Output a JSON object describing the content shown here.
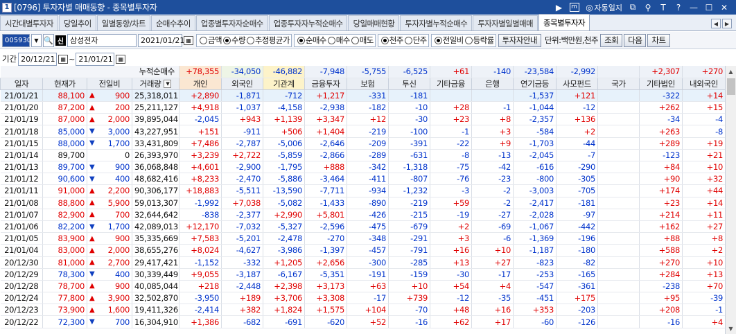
{
  "titlebar": {
    "num": "1",
    "title": "[0796] 투자자별 매매동향 - 종목별투자자",
    "auto_label": "자동일지",
    "icons": [
      "arrow-right-icon",
      "m-icon",
      "auto-journal-icon",
      "copy-icon",
      "pin-icon",
      "font-size-icon",
      "help-icon",
      "minimize-icon",
      "maximize-icon",
      "close-icon"
    ]
  },
  "tabs": [
    "시간대별투자자",
    "당일추이",
    "일별동향/차트",
    "순매수추이",
    "업종별투자자순매수",
    "업종투자자누적순매수",
    "당일매매현황",
    "투자자별누적순매수",
    "투자자별일별매매",
    "종목별투자자"
  ],
  "active_tab": 9,
  "controls": {
    "code": "005930",
    "name": "삼성전자",
    "date": "2021/01/21",
    "sin": "신",
    "radio1": [
      {
        "label": "금액",
        "on": false
      },
      {
        "label": "수량",
        "on": true
      },
      {
        "label": "추정평균가",
        "on": false
      }
    ],
    "radio2": [
      {
        "label": "순매수",
        "on": true
      },
      {
        "label": "매수",
        "on": false
      },
      {
        "label": "매도",
        "on": false
      }
    ],
    "radio3": [
      {
        "label": "천주",
        "on": true
      },
      {
        "label": "단주",
        "on": false
      }
    ],
    "radio4": [
      {
        "label": "전일비",
        "on": true
      },
      {
        "label": "등락률",
        "on": false
      }
    ],
    "guide_btn": "투자자안내",
    "unit": "단위:백만원,천주",
    "search_btn": "조회",
    "next_btn": "다음",
    "chart_btn": "차트"
  },
  "period": {
    "label": "기간",
    "from": "20/12/21",
    "sep": "~",
    "to": "21/01/21",
    "cum_label": "누적순매수",
    "cum_values": [
      "+78,355",
      "-34,050",
      "-46,882",
      "-7,948",
      "-5,755",
      "-6,525",
      "+61",
      "-140",
      "-23,584",
      "-2,992",
      "",
      "+2,307",
      "+270"
    ]
  },
  "headers": [
    "일자",
    "현재가",
    "전일비",
    "거래량",
    "개인",
    "외국인",
    "기관계",
    "금융투자",
    "보험",
    "투신",
    "기타금융",
    "은행",
    "연기금등",
    "사모펀드",
    "국가",
    "기타법인",
    "내외국인"
  ],
  "rows": [
    [
      "21/01/21",
      "88,100",
      "up",
      "900",
      "25,318,011",
      "+2,890",
      "-1,871",
      "-712",
      "+1,217",
      "-331",
      "-181",
      "",
      "",
      "-1,537",
      "+121",
      "",
      "-322",
      "+14"
    ],
    [
      "21/01/20",
      "87,200",
      "up",
      "200",
      "25,211,127",
      "+4,918",
      "-1,037",
      "-4,158",
      "-2,938",
      "-182",
      "-10",
      "+28",
      "-1",
      "-1,044",
      "-12",
      "",
      "+262",
      "+15"
    ],
    [
      "21/01/19",
      "87,000",
      "up",
      "2,000",
      "39,895,044",
      "-2,045",
      "+943",
      "+1,139",
      "+3,347",
      "+12",
      "-30",
      "+23",
      "+8",
      "-2,357",
      "+136",
      "",
      "-34",
      "-4"
    ],
    [
      "21/01/18",
      "85,000",
      "down",
      "3,000",
      "43,227,951",
      "+151",
      "-911",
      "+506",
      "+1,404",
      "-219",
      "-100",
      "-1",
      "+3",
      "-584",
      "+2",
      "",
      "+263",
      "-8"
    ],
    [
      "21/01/15",
      "88,000",
      "down",
      "1,700",
      "33,431,809",
      "+7,486",
      "-2,787",
      "-5,006",
      "-2,646",
      "-209",
      "-391",
      "-22",
      "+9",
      "-1,703",
      "-44",
      "",
      "+289",
      "+19"
    ],
    [
      "21/01/14",
      "89,700",
      "",
      "0",
      "26,393,970",
      "+3,239",
      "+2,722",
      "-5,859",
      "-2,866",
      "-289",
      "-631",
      "-8",
      "-13",
      "-2,045",
      "-7",
      "",
      "-123",
      "+21"
    ],
    [
      "21/01/13",
      "89,700",
      "down",
      "900",
      "36,068,848",
      "+4,601",
      "-2,900",
      "-1,795",
      "+888",
      "-342",
      "-1,318",
      "-75",
      "-42",
      "-616",
      "-290",
      "",
      "+84",
      "+10"
    ],
    [
      "21/01/12",
      "90,600",
      "down",
      "400",
      "48,682,416",
      "+8,233",
      "-2,470",
      "-5,886",
      "-3,464",
      "-411",
      "-807",
      "-76",
      "-23",
      "-800",
      "-305",
      "",
      "+90",
      "+32"
    ],
    [
      "21/01/11",
      "91,000",
      "up",
      "2,200",
      "90,306,177",
      "+18,883",
      "-5,511",
      "-13,590",
      "-7,711",
      "-934",
      "-1,232",
      "-3",
      "-2",
      "-3,003",
      "-705",
      "",
      "+174",
      "+44"
    ],
    [
      "21/01/08",
      "88,800",
      "up",
      "5,900",
      "59,013,307",
      "-1,992",
      "+7,038",
      "-5,082",
      "-1,433",
      "-890",
      "-219",
      "+59",
      "-2",
      "-2,417",
      "-181",
      "",
      "+23",
      "+14"
    ],
    [
      "21/01/07",
      "82,900",
      "up",
      "700",
      "32,644,642",
      "-838",
      "-2,377",
      "+2,990",
      "+5,801",
      "-426",
      "-215",
      "-19",
      "-27",
      "-2,028",
      "-97",
      "",
      "+214",
      "+11"
    ],
    [
      "21/01/06",
      "82,200",
      "down",
      "1,700",
      "42,089,013",
      "+12,170",
      "-7,032",
      "-5,327",
      "-2,596",
      "-475",
      "-679",
      "+2",
      "-69",
      "-1,067",
      "-442",
      "",
      "+162",
      "+27"
    ],
    [
      "21/01/05",
      "83,900",
      "up",
      "900",
      "35,335,669",
      "+7,583",
      "-5,201",
      "-2,478",
      "-270",
      "-348",
      "-291",
      "+3",
      "-6",
      "-1,369",
      "-196",
      "",
      "+88",
      "+8"
    ],
    [
      "21/01/04",
      "83,000",
      "up",
      "2,000",
      "38,655,276",
      "+8,024",
      "-4,627",
      "-3,986",
      "-1,397",
      "-457",
      "-791",
      "+16",
      "+10",
      "-1,187",
      "-180",
      "",
      "+588",
      "+2"
    ],
    [
      "20/12/30",
      "81,000",
      "up",
      "2,700",
      "29,417,421",
      "-1,152",
      "-332",
      "+1,205",
      "+2,656",
      "-300",
      "-285",
      "+13",
      "+27",
      "-823",
      "-82",
      "",
      "+270",
      "+10"
    ],
    [
      "20/12/29",
      "78,300",
      "down",
      "400",
      "30,339,449",
      "+9,055",
      "-3,187",
      "-6,167",
      "-5,351",
      "-191",
      "-159",
      "-30",
      "-17",
      "-253",
      "-165",
      "",
      "+284",
      "+13"
    ],
    [
      "20/12/28",
      "78,700",
      "up",
      "900",
      "40,085,044",
      "+218",
      "-2,448",
      "+2,398",
      "+3,173",
      "+63",
      "+10",
      "+54",
      "+4",
      "-547",
      "-361",
      "",
      "-238",
      "+70"
    ],
    [
      "20/12/24",
      "77,800",
      "up",
      "3,900",
      "32,502,870",
      "-3,950",
      "+189",
      "+3,706",
      "+3,308",
      "-17",
      "+739",
      "-12",
      "-35",
      "-451",
      "+175",
      "",
      "+95",
      "-39"
    ],
    [
      "20/12/23",
      "73,900",
      "up",
      "1,600",
      "19,411,326",
      "-2,414",
      "+382",
      "+1,824",
      "+1,575",
      "+104",
      "-70",
      "+48",
      "+16",
      "+353",
      "-203",
      "",
      "+208",
      "-1"
    ],
    [
      "20/12/22",
      "72,300",
      "down",
      "700",
      "16,304,910",
      "+1,386",
      "-682",
      "-691",
      "-620",
      "+52",
      "-16",
      "+62",
      "+17",
      "-60",
      "-126",
      "",
      "-16",
      "+4"
    ]
  ]
}
